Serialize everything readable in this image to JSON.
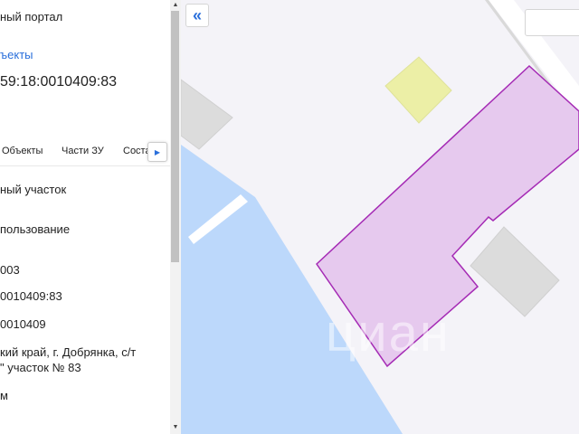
{
  "panel": {
    "portal_title": "ный портал",
    "objects_link": "ъекты",
    "cadastral_number_title": "59:18:0010409:83",
    "tabs": [
      "Объекты",
      "Части ЗУ",
      "Соста"
    ],
    "next_tab_icon": "chevron-right-icon",
    "fields": [
      "ный участок",
      "пользование",
      "003",
      "0010409:83",
      "0010409",
      "кий край, г. Добрянка, с/т",
      "\" участок № 83",
      "м"
    ]
  },
  "map": {
    "collapse_label": "«",
    "watermark": "циан",
    "colors": {
      "water": "#bcd8fb",
      "parcel_fill": "#e6c9ee",
      "parcel_stroke": "#a52bb5",
      "building": "#dcdcdc",
      "yellow_building": "#ecefa6",
      "background": "#f4f3f8",
      "link": "#2a6fdb"
    }
  }
}
